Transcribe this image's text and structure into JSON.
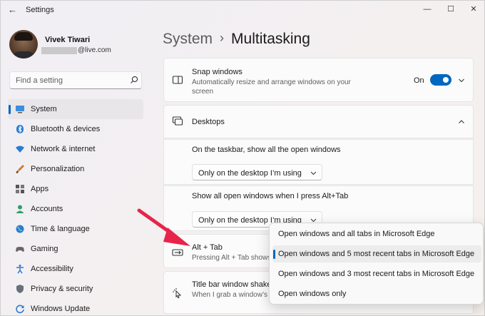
{
  "window": {
    "app_title": "Settings",
    "back_glyph": "←",
    "min_glyph": "—",
    "max_glyph": "☐",
    "close_glyph": "✕"
  },
  "user": {
    "name": "Vivek Tiwari",
    "email_suffix": "@live.com"
  },
  "search": {
    "placeholder": "Find a setting"
  },
  "nav": {
    "items": [
      {
        "label": "System",
        "icon": "monitor-icon",
        "active": true
      },
      {
        "label": "Bluetooth & devices",
        "icon": "bluetooth-icon"
      },
      {
        "label": "Network & internet",
        "icon": "wifi-icon"
      },
      {
        "label": "Personalization",
        "icon": "brush-icon"
      },
      {
        "label": "Apps",
        "icon": "apps-icon"
      },
      {
        "label": "Accounts",
        "icon": "person-icon"
      },
      {
        "label": "Time & language",
        "icon": "globe-icon"
      },
      {
        "label": "Gaming",
        "icon": "gamepad-icon"
      },
      {
        "label": "Accessibility",
        "icon": "accessibility-icon"
      },
      {
        "label": "Privacy & security",
        "icon": "shield-icon"
      },
      {
        "label": "Windows Update",
        "icon": "update-icon"
      }
    ]
  },
  "breadcrumb": {
    "parent": "System",
    "separator": "›",
    "current": "Multitasking"
  },
  "snap": {
    "title": "Snap windows",
    "desc": "Automatically resize and arrange windows on your screen",
    "state": "On",
    "on": true
  },
  "desktops": {
    "title": "Desktops",
    "taskbar_label": "On the taskbar, show all the open windows",
    "taskbar_value": "Only on the desktop I’m using",
    "alttab_label": "Show all open windows when I press Alt+Tab",
    "alttab_value": "Only on the desktop I’m using"
  },
  "alt_tab": {
    "title": "Alt + Tab",
    "desc": "Pressing Alt + Tab shows"
  },
  "titlebar_shake": {
    "title": "Title bar window shake",
    "desc": "When I grab a window’s title bar and shake it, minimize all other windows"
  },
  "popup": {
    "options": [
      {
        "label": "Open windows and all tabs in Microsoft Edge"
      },
      {
        "label": "Open windows and 5 most recent tabs in Microsoft Edge",
        "selected": true
      },
      {
        "label": "Open windows and 3 most recent tabs in Microsoft Edge"
      },
      {
        "label": "Open windows only"
      }
    ]
  },
  "colors": {
    "accent": "#0067c0",
    "arrow": "#e8244a"
  }
}
